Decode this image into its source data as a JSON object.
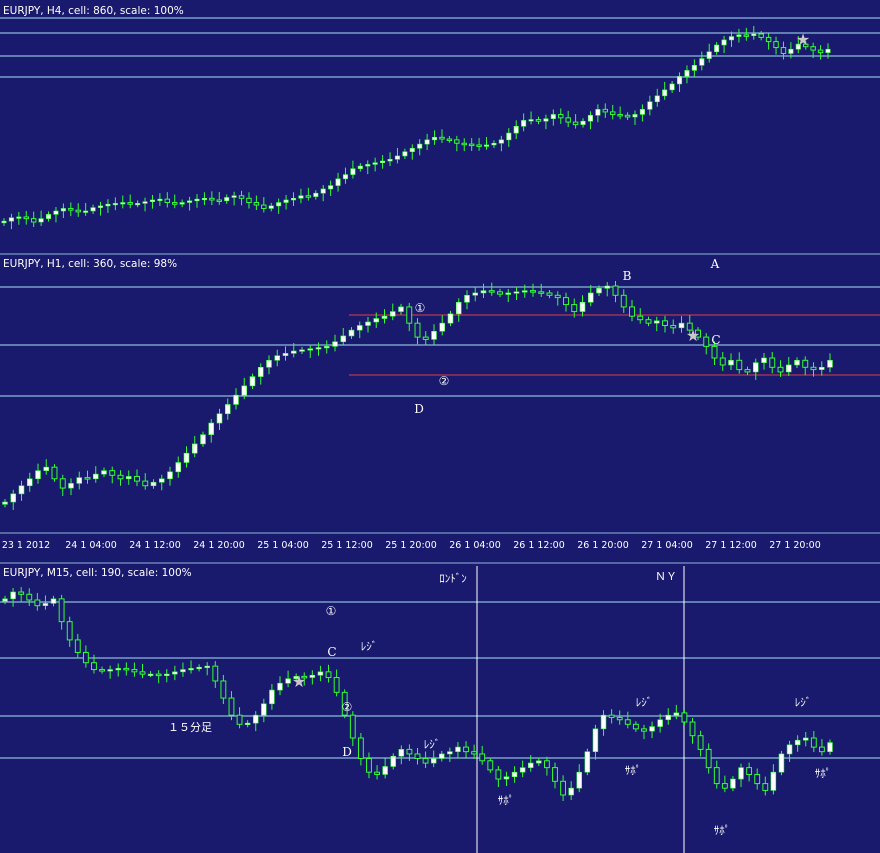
{
  "colors": {
    "background": "#19196e",
    "level_line": "#a9e4f5",
    "red_line": "#e04040",
    "bull_body": "#ffffff",
    "wick": "#33ff33",
    "star": "#c8c8c8",
    "text": "#ffffff"
  },
  "chart_data": [
    {
      "type": "candlestick",
      "title": "EURJPY, H4, cell: 860, scale: 100%",
      "horizontal_levels": 4,
      "annotations": [
        {
          "label": "★",
          "kind": "star-icon"
        }
      ],
      "closes": [
        130,
        134,
        135,
        133,
        129,
        133,
        138,
        142,
        145,
        143,
        141,
        142,
        146,
        148,
        150,
        151,
        152,
        150,
        151,
        153,
        155,
        156,
        152,
        150,
        152,
        154,
        156,
        157,
        155,
        154,
        158,
        160,
        157,
        152,
        149,
        145,
        148,
        152,
        155,
        157,
        160,
        159,
        163,
        168,
        172,
        180,
        185,
        192,
        195,
        197,
        199,
        201,
        203,
        207,
        212,
        216,
        221,
        226,
        229,
        227,
        226,
        222,
        221,
        220,
        219,
        220,
        222,
        226,
        234,
        242,
        249,
        250,
        248,
        251,
        256,
        252,
        247,
        244,
        248,
        255,
        262,
        259,
        256,
        255,
        253,
        256,
        262,
        271,
        278,
        285,
        292,
        301,
        308,
        314,
        322,
        330,
        338,
        344,
        348,
        350,
        349,
        351,
        347,
        342,
        335,
        328,
        333,
        339,
        336,
        332,
        329,
        333
      ]
    },
    {
      "type": "candlestick",
      "title": "EURJPY, H1, cell: 360, scale: 98%",
      "x_tick_labels": [
        "23 1 2012",
        "24 1 04:00",
        "24 1 12:00",
        "24 1 20:00",
        "25 1 04:00",
        "25 1 12:00",
        "25 1 20:00",
        "26 1 04:00",
        "26 1 12:00",
        "26 1 20:00",
        "27 1 04:00",
        "27 1 12:00",
        "27 1 20:00"
      ],
      "horizontal_levels": 3,
      "red_levels": [
        "①",
        "②"
      ],
      "annotations": [
        {
          "label": "A"
        },
        {
          "label": "B"
        },
        {
          "label": "C"
        },
        {
          "label": "D"
        },
        {
          "label": "①"
        },
        {
          "label": "②"
        },
        {
          "label": "★",
          "kind": "star-icon"
        }
      ],
      "closes": [
        98,
        105,
        112,
        118,
        125,
        128,
        118,
        110,
        114,
        119,
        118,
        122,
        125,
        121,
        118,
        120,
        116,
        112,
        115,
        118,
        124,
        132,
        140,
        148,
        156,
        166,
        174,
        182,
        190,
        198,
        206,
        214,
        220,
        224,
        226,
        228,
        229,
        230,
        231,
        232,
        236,
        241,
        246,
        250,
        253,
        256,
        258,
        262,
        266,
        252,
        240,
        238,
        245,
        252,
        260,
        270,
        276,
        278,
        280,
        279,
        277,
        278,
        279,
        280,
        279,
        278,
        276,
        274,
        268,
        262,
        270,
        278,
        282,
        284,
        276,
        266,
        258,
        255,
        252,
        254,
        250,
        248,
        252,
        246,
        240,
        232,
        222,
        216,
        220,
        212,
        210,
        218,
        222,
        214,
        210,
        216,
        220,
        214,
        212,
        214,
        220
      ]
    },
    {
      "type": "candlestick",
      "title": "EURJPY, M15, cell: 190, scale: 100%",
      "session_labels": [
        "ﾛﾝﾄﾞﾝ",
        "ＮＹ"
      ],
      "horizontal_levels": 4,
      "annotations": [
        {
          "label": "①"
        },
        {
          "label": "C"
        },
        {
          "label": "②"
        },
        {
          "label": "D"
        },
        {
          "label": "１５分足"
        },
        {
          "label": "ﾚｼﾞ"
        },
        {
          "label": "ﾚｼﾞ"
        },
        {
          "label": "ﾚｼﾞ"
        },
        {
          "label": "ﾚｼﾞ"
        },
        {
          "label": "ｻﾎﾟ"
        },
        {
          "label": "ｻﾎﾟ"
        },
        {
          "label": "ｻﾎﾟ"
        },
        {
          "label": "ｻﾎﾟ"
        },
        {
          "label": "★",
          "kind": "star-icon"
        }
      ],
      "closes": [
        252,
        258,
        256,
        251,
        246,
        248,
        252,
        232,
        216,
        205,
        196,
        190,
        189,
        190,
        191,
        190,
        188,
        186,
        186,
        185,
        186,
        188,
        190,
        191,
        192,
        193,
        180,
        165,
        150,
        142,
        143,
        150,
        160,
        172,
        178,
        182,
        184,
        183,
        185,
        188,
        183,
        170,
        150,
        130,
        112,
        100,
        98,
        105,
        114,
        120,
        116,
        112,
        108,
        112,
        116,
        118,
        122,
        118,
        116,
        110,
        102,
        94,
        96,
        100,
        104,
        108,
        110,
        104,
        92,
        80,
        86,
        100,
        118,
        138,
        150,
        148,
        146,
        142,
        138,
        136,
        140,
        146,
        150,
        152,
        144,
        132,
        120,
        104,
        90,
        86,
        94,
        104,
        98,
        90,
        84,
        100,
        116,
        124,
        128,
        130,
        122,
        118,
        126
      ]
    }
  ]
}
